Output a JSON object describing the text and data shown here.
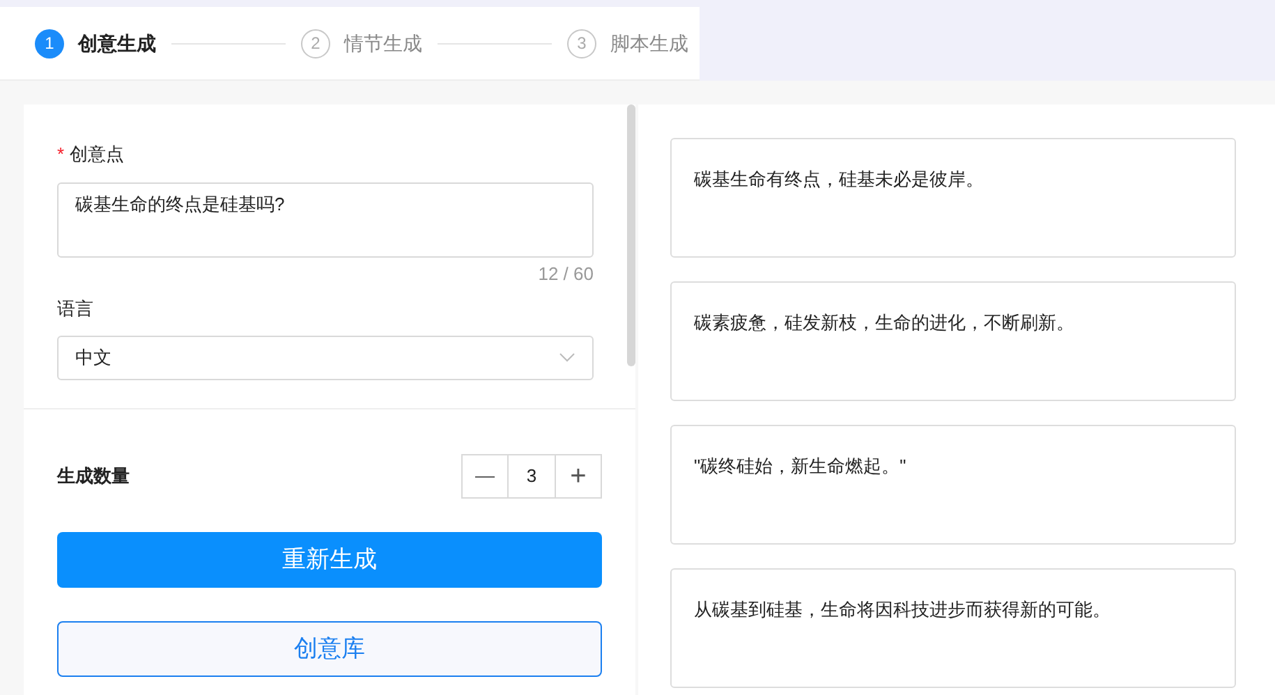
{
  "steps": [
    {
      "number": "1",
      "label": "创意生成",
      "selected": true
    },
    {
      "number": "2",
      "label": "情节生成",
      "selected": false
    },
    {
      "number": "3",
      "label": "脚本生成",
      "selected": false
    }
  ],
  "form": {
    "idea_label": "创意点",
    "required_mark": "*",
    "idea_value": "碳基生命的终点是硅基吗?",
    "counter": "12 / 60",
    "language_label": "语言",
    "language_value": "中文"
  },
  "quantity": {
    "label": "生成数量",
    "minus": "—",
    "value": "3",
    "plus": "+"
  },
  "buttons": [
    {
      "kind": "primary",
      "label": "重新生成"
    },
    {
      "kind": "outline",
      "label": "创意库"
    }
  ],
  "results": [
    {
      "text": "碳基生命有终点，硅基未必是彼岸。"
    },
    {
      "text": "碳素疲惫，硅发新枝，生命的进化，不断刷新。"
    },
    {
      "text": "\"碳终硅始，新生命燃起。\""
    },
    {
      "text": "从碳基到硅基，生命将因科技进步而获得新的可能。"
    }
  ]
}
